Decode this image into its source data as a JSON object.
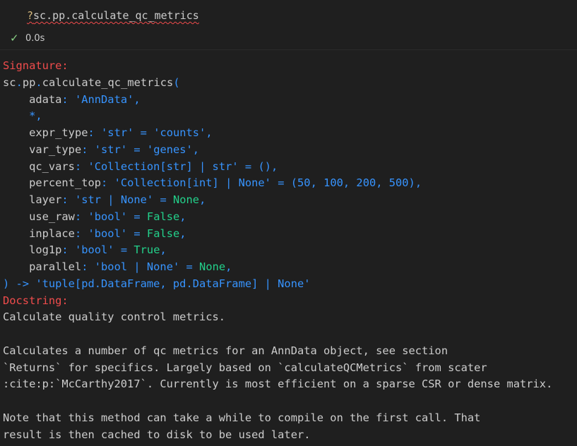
{
  "cell": {
    "code_prefix": "?",
    "code_text": "sc.pp.calculate_qc_metrics",
    "status_icon": "check-icon",
    "exec_time": "0.0s"
  },
  "output": {
    "signature_header": "Signature:",
    "func_name": "sc.pp.calculate_qc_metrics(",
    "params": [
      {
        "name": "adata",
        "type": "'AnnData'",
        "default": "",
        "suffix": ","
      },
      {
        "name": "*",
        "type": "",
        "default": "",
        "suffix": ","
      },
      {
        "name": "expr_type",
        "type": "'str'",
        "default": "'counts'",
        "suffix": ","
      },
      {
        "name": "var_type",
        "type": "'str'",
        "default": "'genes'",
        "suffix": ","
      },
      {
        "name": "qc_vars",
        "type": "'Collection[str] | str'",
        "default": "()",
        "suffix": ","
      },
      {
        "name": "percent_top",
        "type": "'Collection[int] | None'",
        "default": "(50, 100, 200, 500)",
        "suffix": ","
      },
      {
        "name": "layer",
        "type": "'str | None'",
        "default": "None",
        "suffix": ","
      },
      {
        "name": "use_raw",
        "type": "'bool'",
        "default": "False",
        "suffix": ","
      },
      {
        "name": "inplace",
        "type": "'bool'",
        "default": "False",
        "suffix": ","
      },
      {
        "name": "log1p",
        "type": "'bool'",
        "default": "True",
        "suffix": ","
      },
      {
        "name": "parallel",
        "type": "'bool | None'",
        "default": "None",
        "suffix": ","
      }
    ],
    "return_line": ") -> 'tuple[pd.DataFrame, pd.DataFrame] | None'",
    "docstring_header": "Docstring:",
    "doc_lines": [
      "Calculate quality control metrics.",
      "",
      "Calculates a number of qc metrics for an AnnData object, see section",
      "`Returns` for specifics. Largely based on `calculateQCMetrics` from scater",
      ":cite:p:`McCarthy2017`. Currently is most efficient on a sparse CSR or dense matrix.",
      "",
      "Note that this method can take a while to compile on the first call. That",
      "result is then cached to disk to be used later."
    ]
  }
}
